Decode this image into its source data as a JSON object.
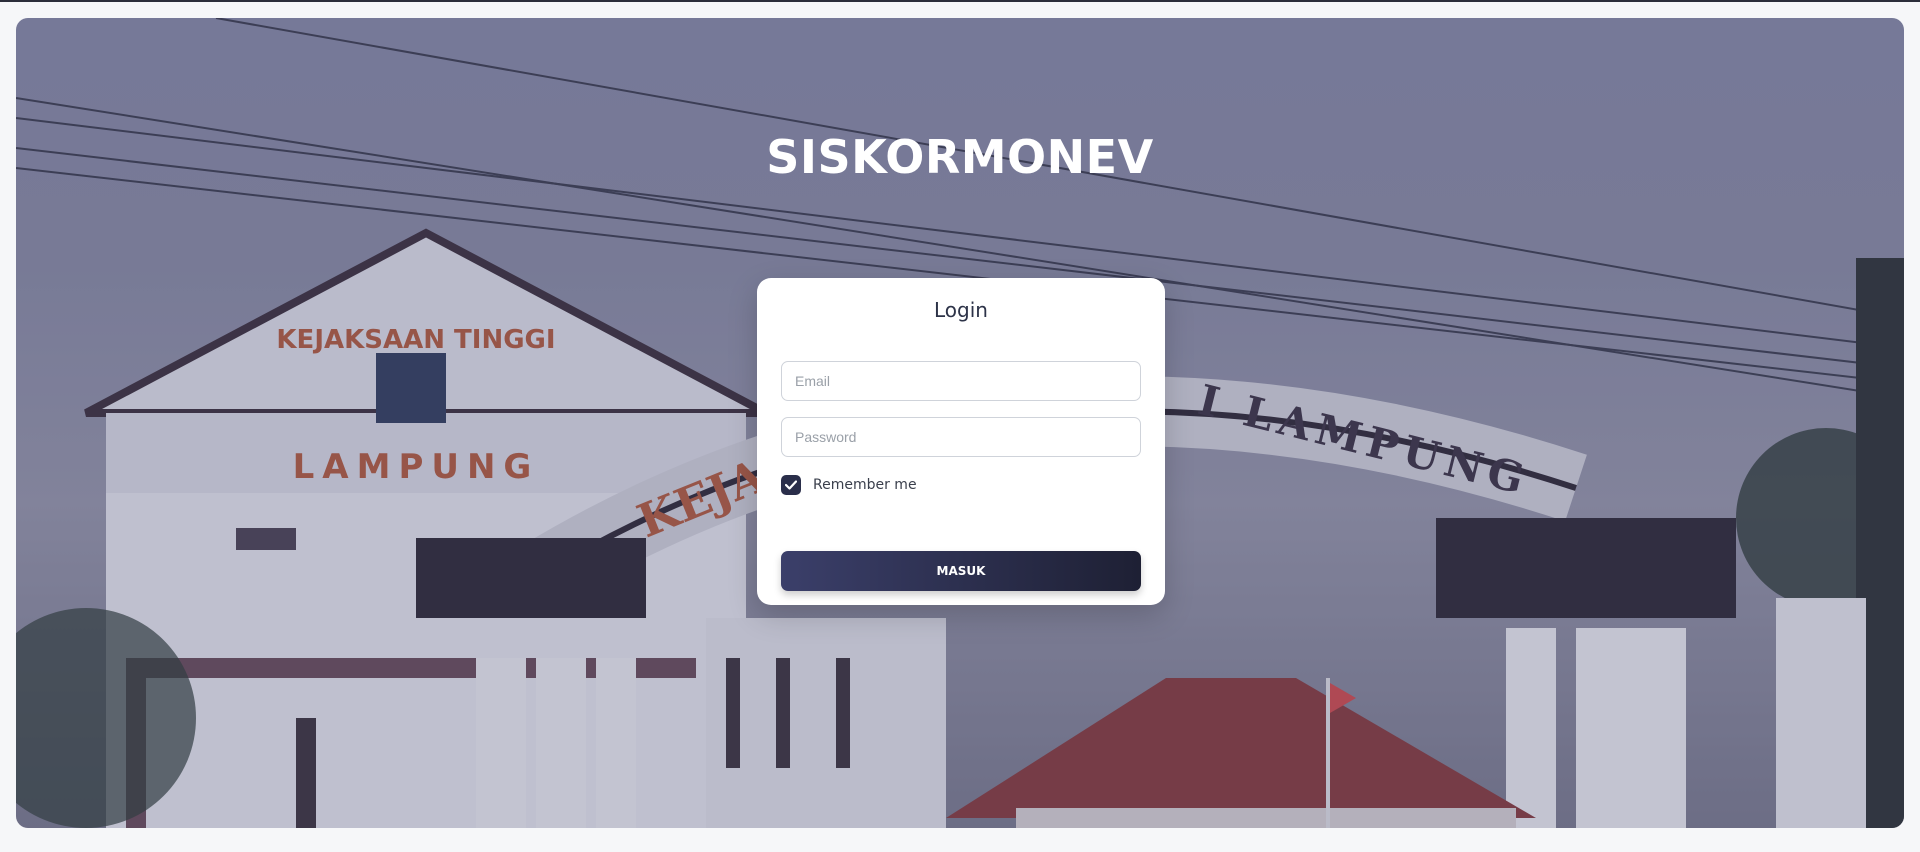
{
  "app": {
    "title": "SISKORMONEV"
  },
  "background": {
    "sign_top": "KEJAKSAAN TINGGI",
    "sign_main": "LAMPUNG",
    "arch_left": "KEJA",
    "arch_right": "I LAMPUNG"
  },
  "login": {
    "title": "Login",
    "email_placeholder": "Email",
    "password_placeholder": "Password",
    "remember_label": "Remember me",
    "remember_checked": true,
    "submit_label": "MASUK"
  },
  "colors": {
    "button_start": "#3b3f6a",
    "button_end": "#1e2034",
    "checkbox": "#2a2e4a"
  }
}
